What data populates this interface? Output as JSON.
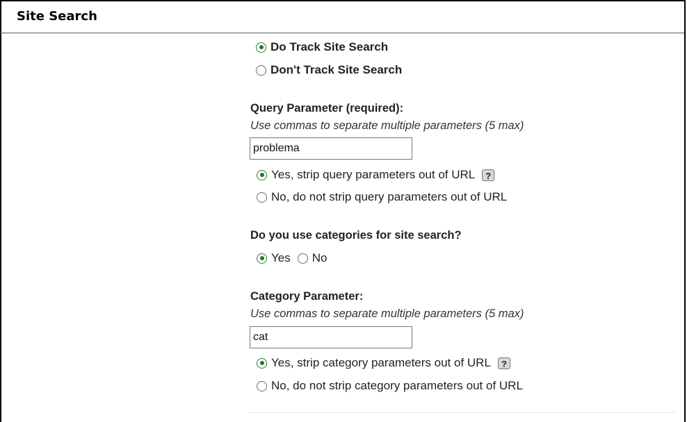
{
  "header": {
    "title": "Site Search"
  },
  "tracking": {
    "do_track_label": "Do Track Site Search",
    "dont_track_label": "Don't Track Site Search",
    "selected": "do"
  },
  "query": {
    "label": "Query Parameter (required):",
    "hint": "Use commas to separate multiple parameters (5 max)",
    "value": "problema",
    "strip_yes_label": "Yes, strip query parameters out of URL",
    "strip_no_label": "No, do not strip query parameters out of URL",
    "strip_selected": "yes",
    "help_icon": "?"
  },
  "categories": {
    "question": "Do you use categories for site search?",
    "yes_label": "Yes",
    "no_label": "No",
    "selected": "yes"
  },
  "category_param": {
    "label": "Category Parameter:",
    "hint": "Use commas to separate multiple parameters (5 max)",
    "value": "cat",
    "strip_yes_label": "Yes, strip category parameters out of URL",
    "strip_no_label": "No, do not strip category parameters out of URL",
    "strip_selected": "yes",
    "help_icon": "?"
  },
  "colors": {
    "radio_checked": "#1e7a1e",
    "border": "#000000"
  }
}
